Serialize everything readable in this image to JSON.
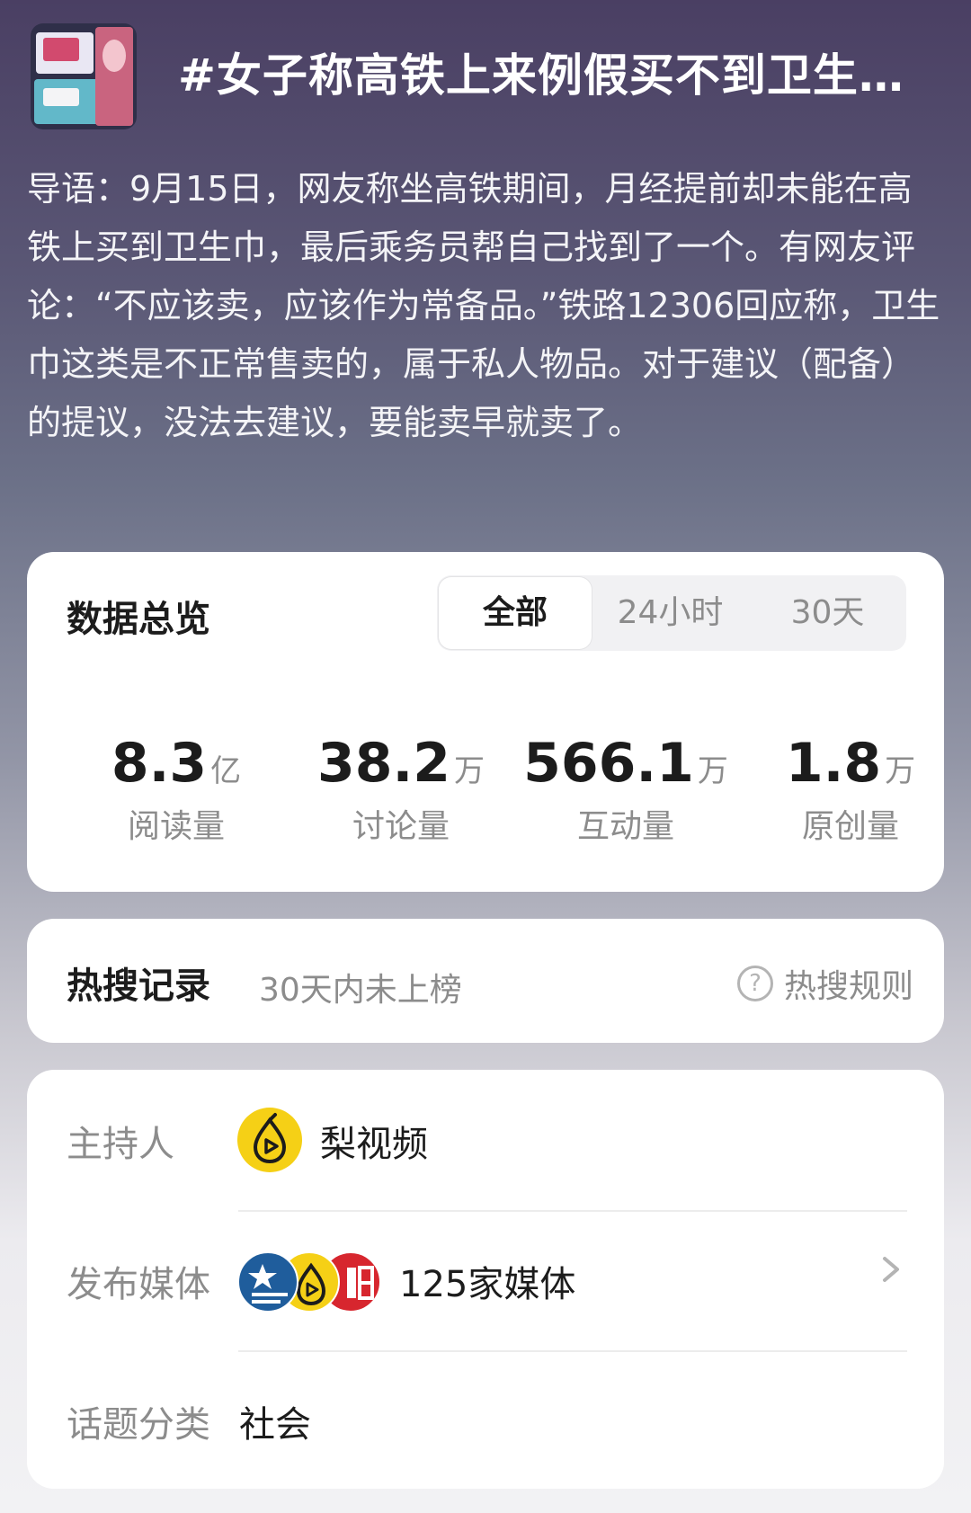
{
  "topic": {
    "title": "#女子称高铁上来例假买不到卫生…",
    "intro": "导语：9月15日，网友称坐高铁期间，月经提前却未能在高铁上买到卫生巾，最后乘务员帮自己找到了一个。有网友评论：“不应该卖，应该作为常备品。”铁路12306回应称，卫生巾这类是不正常售卖的，属于私人物品。对于建议（配备）的提议，没法去建议，要能卖早就卖了。"
  },
  "overview": {
    "title": "数据总览",
    "tabs": [
      "全部",
      "24小时",
      "30天"
    ],
    "active_tab": 0,
    "stats": [
      {
        "value": "8.3",
        "unit": "亿",
        "label": "阅读量"
      },
      {
        "value": "38.2",
        "unit": "万",
        "label": "讨论量"
      },
      {
        "value": "566.1",
        "unit": "万",
        "label": "互动量"
      },
      {
        "value": "1.8",
        "unit": "万",
        "label": "原创量"
      }
    ]
  },
  "hot_search": {
    "title": "热搜记录",
    "subtitle": "30天内未上榜",
    "rules_label": "热搜规则"
  },
  "info": {
    "host_label": "主持人",
    "host_value": "梨视频",
    "media_label": "发布媒体",
    "media_value": "125家媒体",
    "category_label": "话题分类",
    "category_value": "社会"
  },
  "icons": {
    "pear_logo": "pear-video-logo",
    "media_logos": [
      "china-newsweek-logo",
      "pear-video-logo",
      "red-media-logo"
    ],
    "rules": "question-circle-icon",
    "chevron": "chevron-right-icon"
  },
  "colors": {
    "accent_yellow": "#f5d016",
    "card_bg": "#ffffff",
    "text_primary": "#1c1c1c",
    "text_secondary": "#8c8c8c"
  }
}
